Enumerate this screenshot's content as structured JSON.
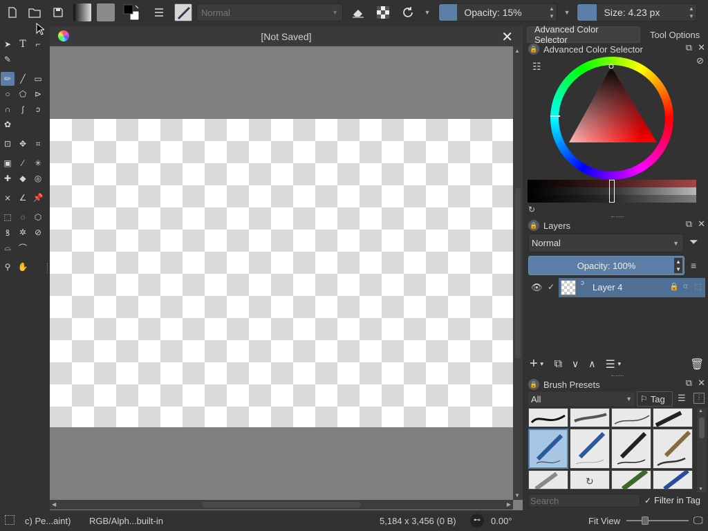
{
  "toolbar": {
    "blend_mode": "Normal",
    "opacity_label": "Opacity: 15%",
    "opacity_value": 0.15,
    "size_label": "Size: 4.23 px"
  },
  "canvas": {
    "title": "[Not Saved]"
  },
  "right_panel": {
    "tabs": [
      {
        "label": "Advanced Color Selector"
      },
      {
        "label": "Tool Options"
      }
    ],
    "color_selector": {
      "title": "Advanced Color Selector"
    },
    "layers": {
      "title": "Layers",
      "blend_mode": "Normal",
      "opacity_label": "Opacity:  100%",
      "opacity_value": 1.0,
      "items": [
        {
          "name": "Layer 4"
        }
      ]
    },
    "brush_presets": {
      "title": "Brush Presets",
      "filter": "All",
      "tag_label": "Tag",
      "search_placeholder": "Search",
      "filter_in_tag_label": "Filter in Tag"
    }
  },
  "statusbar": {
    "brush_name": "c) Pe...aint)",
    "color_profile": "RGB/Alph...built-in",
    "image_size": "5,184 x 3,456 (0 B)",
    "rotation": "0.00°",
    "zoom_mode": "Fit View"
  },
  "colors": {
    "accent": "#5b7fa6",
    "selected_layer": "#4f6f94",
    "background": "#323232",
    "canvas_bg": "#7f7f7f"
  }
}
